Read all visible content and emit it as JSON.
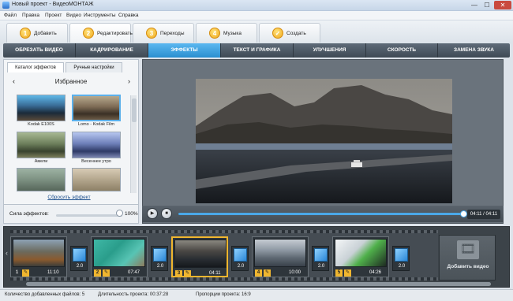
{
  "window": {
    "title": "Новый проект - ВидеоМОНТАЖ",
    "minimize": "—",
    "maximize": "☐",
    "close": "✕"
  },
  "menu": [
    "Файл",
    "Правка",
    "Проект",
    "Видео",
    "Инструменты",
    "Справка"
  ],
  "steps": [
    {
      "num": "1",
      "label": "Добавить"
    },
    {
      "num": "2",
      "label": "Редактировать"
    },
    {
      "num": "3",
      "label": "Переходы"
    },
    {
      "num": "4",
      "label": "Музыка"
    },
    {
      "num": "✓",
      "label": "Создать"
    }
  ],
  "subtabs": [
    "ОБРЕЗАТЬ ВИДЕО",
    "КАДРИРОВАНИЕ",
    "ЭФФЕКТЫ",
    "ТЕКСТ И ГРАФИКА",
    "УЛУЧШЕНИЯ",
    "СКОРОСТЬ",
    "ЗАМЕНА ЗВУКА"
  ],
  "effects_panel": {
    "tabs": [
      "Каталог эффектов",
      "Ручные настройки"
    ],
    "category": "Избранное",
    "prev": "‹",
    "next": "›",
    "effects": [
      "Kodak E100S",
      "Lomo - Kodak Film",
      "Амели",
      "Весеннее утро",
      "",
      ""
    ],
    "reset_link": "Сбросить эффект",
    "strength_label": "Сила эффектов:",
    "strength_value": "100%",
    "strength_fraction": 1.0
  },
  "player": {
    "play_icon": "▶",
    "stop_icon": "■",
    "time": "04:11 / 04:11",
    "progress_fraction": 1.0
  },
  "timeline": {
    "left_arrow": "‹",
    "clips": [
      {
        "num": "1",
        "duration": "11:10"
      },
      {
        "num": "2",
        "duration": "07:47"
      },
      {
        "num": "3",
        "duration": "04:11"
      },
      {
        "num": "4",
        "duration": "10:00"
      },
      {
        "num": "5",
        "duration": "04:26"
      }
    ],
    "transitions": [
      "2.0",
      "2.0",
      "2.0",
      "2.0",
      "2.0"
    ],
    "pen_icon": "✎",
    "add_video_icon": "🎞",
    "add_video_label": "Добавить видео"
  },
  "status": {
    "files": "Количество добавленных файлов: 5",
    "duration": "Длительность проекта:  00:37:28",
    "aspect": "Пропорции проекта:  16:9"
  },
  "colors": {
    "accent": "#2a8fd0",
    "clip_highlight": "#f0b62f"
  }
}
